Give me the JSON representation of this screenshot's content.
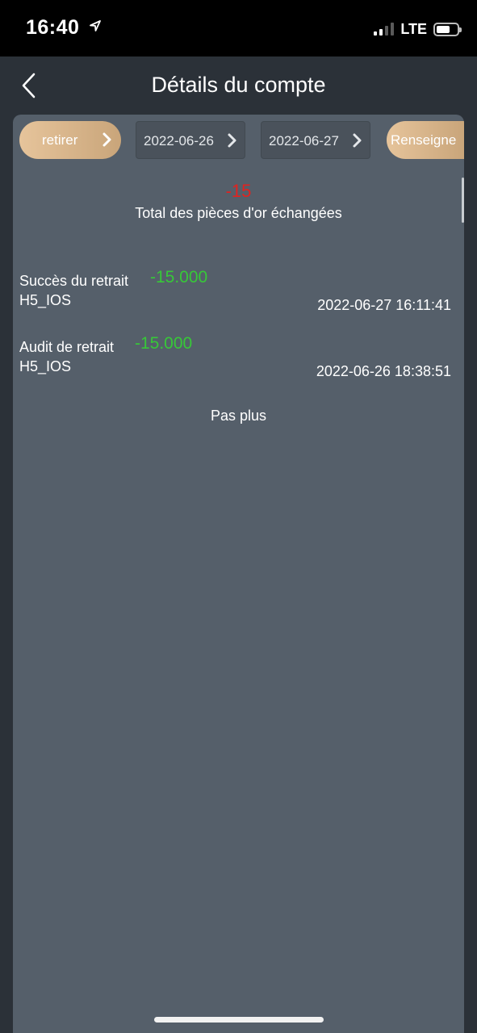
{
  "status_bar": {
    "time": "16:40",
    "network": "LTE",
    "signal_bars_active": 2,
    "signal_bars_total": 4,
    "battery_level": 0.65
  },
  "header": {
    "title": "Détails du compte",
    "back_icon": "chevron-left-icon"
  },
  "filters": {
    "type_button_label": "retirer",
    "start_date": "2022-06-26",
    "end_date": "2022-06-27",
    "search_button_label": "Renseigne",
    "accent_color": "#d9b68a"
  },
  "summary": {
    "total": "-15",
    "label": "Total des pièces d'or échangées",
    "total_color": "#e2221f"
  },
  "records": [
    {
      "type": "Succès du retrait",
      "amount": "-15.000",
      "source": "H5_IOS",
      "time": "2022-06-27 16:11:41"
    },
    {
      "type": "Audit de retrait",
      "amount": "-15.000",
      "source": "H5_IOS",
      "time": "2022-06-26 18:38:51"
    }
  ],
  "amount_color": "#37c838",
  "footer_text": "Pas plus"
}
